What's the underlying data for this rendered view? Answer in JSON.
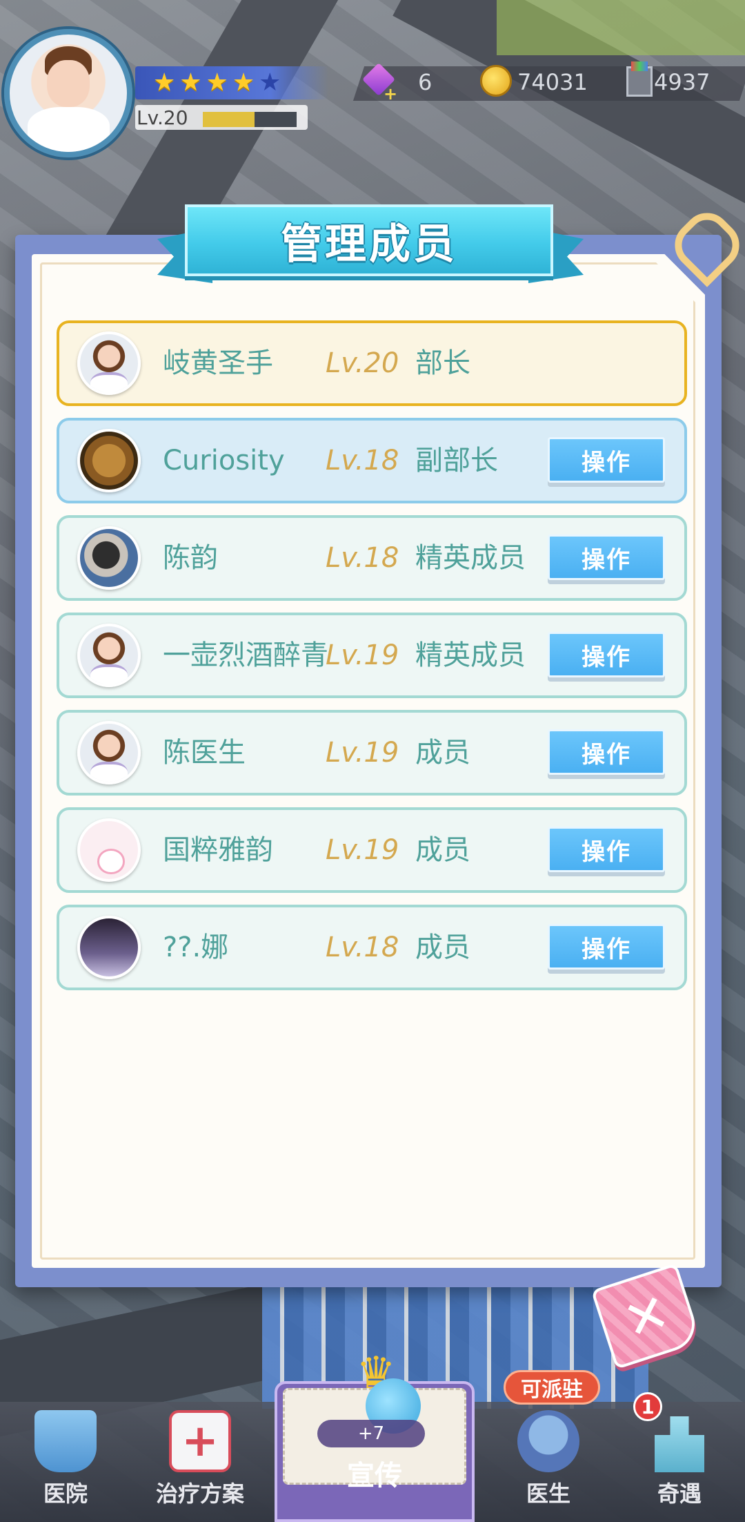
{
  "hud": {
    "level": "Lv.20",
    "level_progress": 0.55,
    "stars_filled": 4,
    "stars_total": 5,
    "gems": "6",
    "coins": "74031",
    "materials": "4937"
  },
  "dialog": {
    "title": "管理成员",
    "members": [
      {
        "name": "岐黄圣手",
        "level": "Lv.20",
        "role": "部长",
        "has_action": false,
        "style": "leader",
        "avatar": "nurse-avatar"
      },
      {
        "name": "Curiosity",
        "level": "Lv.18",
        "role": "副部长",
        "has_action": true,
        "style": "deputy",
        "avatar": "cat-avatar"
      },
      {
        "name": "陈韵",
        "level": "Lv.18",
        "role": "精英成员",
        "has_action": true,
        "style": "normal",
        "avatar": "photo-avatar"
      },
      {
        "name": "一壶烈酒醉青",
        "level": "Lv.19",
        "role": "精英成员",
        "has_action": true,
        "style": "normal",
        "avatar": "nurse-avatar"
      },
      {
        "name": "陈医生",
        "level": "Lv.19",
        "role": "成员",
        "has_action": true,
        "style": "normal",
        "avatar": "nurse-avatar"
      },
      {
        "name": "国粹雅韵",
        "level": "Lv.19",
        "role": "成员",
        "has_action": true,
        "style": "normal",
        "avatar": "sticker-avatar"
      },
      {
        "name": "??.娜",
        "level": "Lv.18",
        "role": "成员",
        "has_action": true,
        "style": "normal",
        "avatar": "dark-avatar"
      }
    ],
    "action_label": "操作",
    "close_glyph": "✕"
  },
  "bottom_nav": {
    "items": [
      {
        "label": "医院",
        "icon": "hospital-icon"
      },
      {
        "label": "治疗方案",
        "icon": "medkit-icon"
      },
      {
        "label": "宣传",
        "icon": "promotion-icon"
      },
      {
        "label": "医生",
        "icon": "doctor-icon"
      },
      {
        "label": "奇遇",
        "icon": "city-icon"
      }
    ],
    "promo_count": "+7",
    "dispatch_badge": "可派驻",
    "notice_count": "1"
  }
}
